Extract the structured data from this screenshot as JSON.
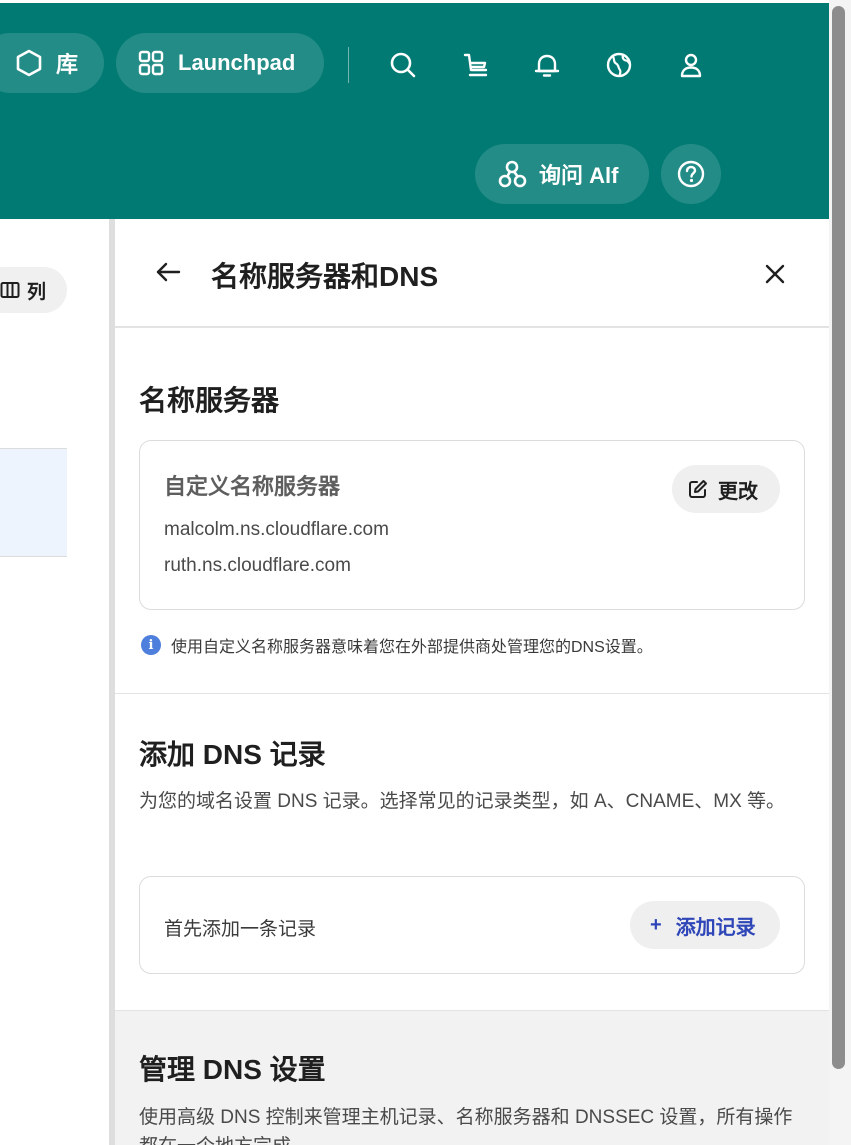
{
  "header": {
    "library_label": "库",
    "launchpad_label": "Launchpad",
    "ask_alf_label": "询问 Alf",
    "icons": [
      "hexagon-icon",
      "grid-icon",
      "search-icon",
      "cart-icon",
      "bell-icon",
      "globe-icon",
      "user-icon",
      "alf-icon",
      "help-icon"
    ],
    "color": "#007a73"
  },
  "left_pane": {
    "columns_label": "列"
  },
  "drawer": {
    "title": "名称服务器和DNS",
    "nameservers": {
      "section_title": "名称服务器",
      "card_title": "自定义名称服务器",
      "change_label": "更改",
      "servers": [
        "malcolm.ns.cloudflare.com",
        "ruth.ns.cloudflare.com"
      ],
      "info_text": "使用自定义名称服务器意味着您在外部提供商处管理您的DNS设置。"
    },
    "add_dns": {
      "section_title": "添加 DNS 记录",
      "description": "为您的域名设置 DNS 记录。选择常见的记录类型，如 A、CNAME、MX 等。",
      "empty_text": "首先添加一条记录",
      "add_label": "添加记录",
      "add_prefix": "+"
    },
    "manage_dns": {
      "section_title": "管理 DNS 设置",
      "description": "使用高级 DNS 控制来管理主机记录、名称服务器和 DNSSEC 设置，所有操作都在一个地方完成。"
    }
  }
}
